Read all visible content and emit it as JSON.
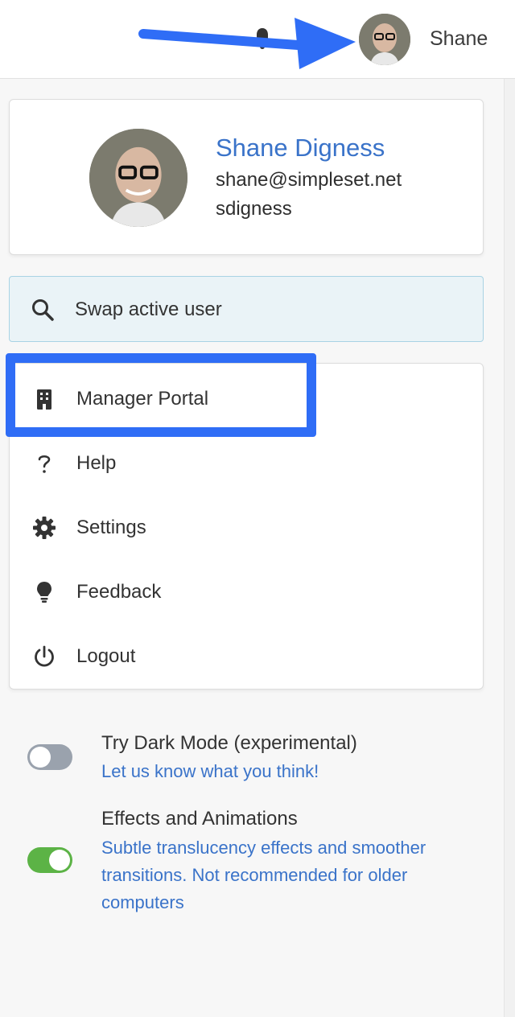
{
  "header": {
    "username": "Shane",
    "colors": {
      "annotation": "#2f6df6"
    }
  },
  "profile": {
    "name": "Shane Digness",
    "email": "shane@simpleset.net",
    "handle": "sdigness"
  },
  "swap": {
    "label": "Swap active user"
  },
  "menu": {
    "items": [
      {
        "label": "Manager Portal",
        "icon": "building-icon"
      },
      {
        "label": "Help",
        "icon": "question-icon"
      },
      {
        "label": "Settings",
        "icon": "gear-icon"
      },
      {
        "label": "Feedback",
        "icon": "lightbulb-icon"
      },
      {
        "label": "Logout",
        "icon": "power-icon"
      }
    ]
  },
  "options": {
    "dark_mode": {
      "title": "Try Dark Mode (experimental)",
      "description": "Let us know what you think!",
      "enabled": false
    },
    "effects": {
      "title": "Effects and Animations",
      "description": "Subtle translucency effects and smoother transitions. Not recommended for older computers",
      "enabled": true
    }
  },
  "colors": {
    "link_blue": "#3a73c9",
    "toggle_on": "#5cb346",
    "toggle_off": "#9aa2ad",
    "swap_bg": "#eaf3f7"
  }
}
